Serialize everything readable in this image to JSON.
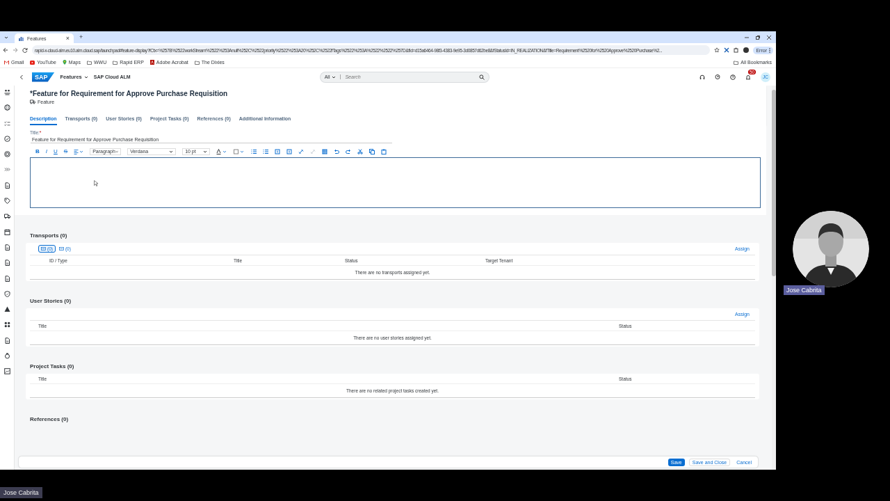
{
  "browser": {
    "tab": {
      "title": "Features",
      "close": "×"
    },
    "new_tab": "+",
    "url": "rapid-x-cloud-alm.eu10.alm.cloud.sap/launchpad#feature-display?fCtx=%257B%2522workStream%2522%253Anull%252C%2522priority%2522%253A20%252C%2522fTags%2522%253A%2522%2522%257D&fId=d15a6464-98f3-4383-9e95-3d0857d62be8&fStatusId=IN_REALIZATION&fTitle=Requirement%2520for%2520Approve%2520Purchase%2...",
    "profile_chip": "Error",
    "bookmarks": [
      {
        "label": "Gmail",
        "kind": "gmail"
      },
      {
        "label": "YouTube",
        "kind": "youtube"
      },
      {
        "label": "Maps",
        "kind": "maps"
      },
      {
        "label": "WWU",
        "kind": "folder"
      },
      {
        "label": "Rapid ERP",
        "kind": "folder"
      },
      {
        "label": "Adobe Acrobat",
        "kind": "acrobat"
      },
      {
        "label": "The Dixies",
        "kind": "folder"
      }
    ],
    "all_bookmarks": "All Bookmarks"
  },
  "shell": {
    "logo": "SAP",
    "app": "Features",
    "product": "SAP Cloud ALM",
    "search_scope": "All",
    "search_placeholder": "Search",
    "notifications": "50",
    "avatar": "JC"
  },
  "page": {
    "title": "*Feature for Requirement for Approve Purchase Requisition",
    "type": "Feature",
    "tabs": [
      {
        "label": "Description",
        "selected": true
      },
      {
        "label": "Transports (0)",
        "selected": false
      },
      {
        "label": "User Stories (0)",
        "selected": false
      },
      {
        "label": "Project Tasks (0)",
        "selected": false
      },
      {
        "label": "References (0)",
        "selected": false
      },
      {
        "label": "Additional Information",
        "selected": false
      }
    ],
    "title_field": {
      "label": "Title:",
      "required": "*",
      "value": "Feature for Requirement for Approve Purchase Requisition"
    },
    "editor": {
      "format_buttons": [
        {
          "label": "B",
          "kind": "bold"
        },
        {
          "label": "I",
          "kind": "italic"
        },
        {
          "label": "U",
          "kind": "underline"
        },
        {
          "label": "S",
          "kind": "strike"
        }
      ],
      "block_format": "Paragraph",
      "font": "Verdana",
      "size": "10 pt"
    },
    "sections": [
      {
        "kind": "transports",
        "heading": "Transports (0)",
        "filters": [
          {
            "count": "(0)",
            "selected": true
          },
          {
            "count": "(0)",
            "selected": false
          }
        ],
        "action": "Assign",
        "columns": [
          "ID / Type",
          "Title",
          "Status",
          "Target Tenant"
        ],
        "empty": "There are no transports assigned yet."
      },
      {
        "kind": "stories",
        "heading": "User Stories (0)",
        "action": "Assign",
        "columns": [
          "Title",
          "Status"
        ],
        "empty": "There are no user stories assigned yet."
      },
      {
        "kind": "tasks",
        "heading": "Project Tasks (0)",
        "columns": [
          "Title",
          "Status"
        ],
        "empty": "There are no related project tasks created yet."
      },
      {
        "kind": "references",
        "heading": "References (0)"
      }
    ],
    "footer": {
      "save": "Save",
      "save_close": "Save and Close",
      "cancel": "Cancel"
    }
  },
  "call": {
    "tile_name": "Jose Cabrita",
    "self_name": "Jose Cabrita"
  }
}
